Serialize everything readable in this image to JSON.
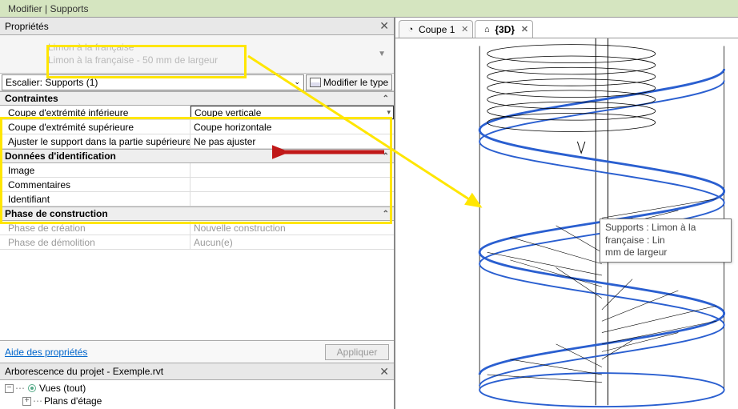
{
  "window_title": "Modifier | Supports",
  "props_panel_title": "Propriétés",
  "type_selector": {
    "family": "Limon à la française",
    "type": "Limon à la française - 50 mm de largeur"
  },
  "filter_label": "Escalier: Supports (1)",
  "edit_type_label": "Modifier le type",
  "sections": {
    "constraints": {
      "title": "Contraintes",
      "rows": {
        "lower_end_cut": {
          "label": "Coupe d'extrémité inférieure",
          "value": "Coupe verticale"
        },
        "upper_end_cut": {
          "label": "Coupe d'extrémité supérieure",
          "value": "Coupe horizontale"
        },
        "adjust_support": {
          "label": "Ajuster le support dans la partie supérieure",
          "value": "Ne pas ajuster"
        }
      }
    },
    "identity": {
      "title": "Données d'identification",
      "rows": {
        "image": {
          "label": "Image",
          "value": ""
        },
        "comments": {
          "label": "Commentaires",
          "value": ""
        },
        "identifier": {
          "label": "Identifiant",
          "value": ""
        }
      }
    },
    "phasing": {
      "title": "Phase de construction",
      "rows": {
        "created": {
          "label": "Phase de création",
          "value": "Nouvelle construction"
        },
        "demolished": {
          "label": "Phase de démolition",
          "value": "Aucun(e)"
        }
      }
    }
  },
  "props_help_link": "Aide des propriétés",
  "apply_label": "Appliquer",
  "tree_title": "Arborescence du projet - Exemple.rvt",
  "tree": {
    "root": "Vues (tout)",
    "child": "Plans d'étage"
  },
  "tabs": {
    "tab1": "Coupe 1",
    "tab2": "{3D}"
  },
  "tooltip_text": "Supports : Limon à la française : Lin\nmm de largeur",
  "colors": {
    "annotation_yellow": "#ffe600",
    "annotation_red": "#c01818",
    "selection_blue": "#2a5fd0"
  }
}
